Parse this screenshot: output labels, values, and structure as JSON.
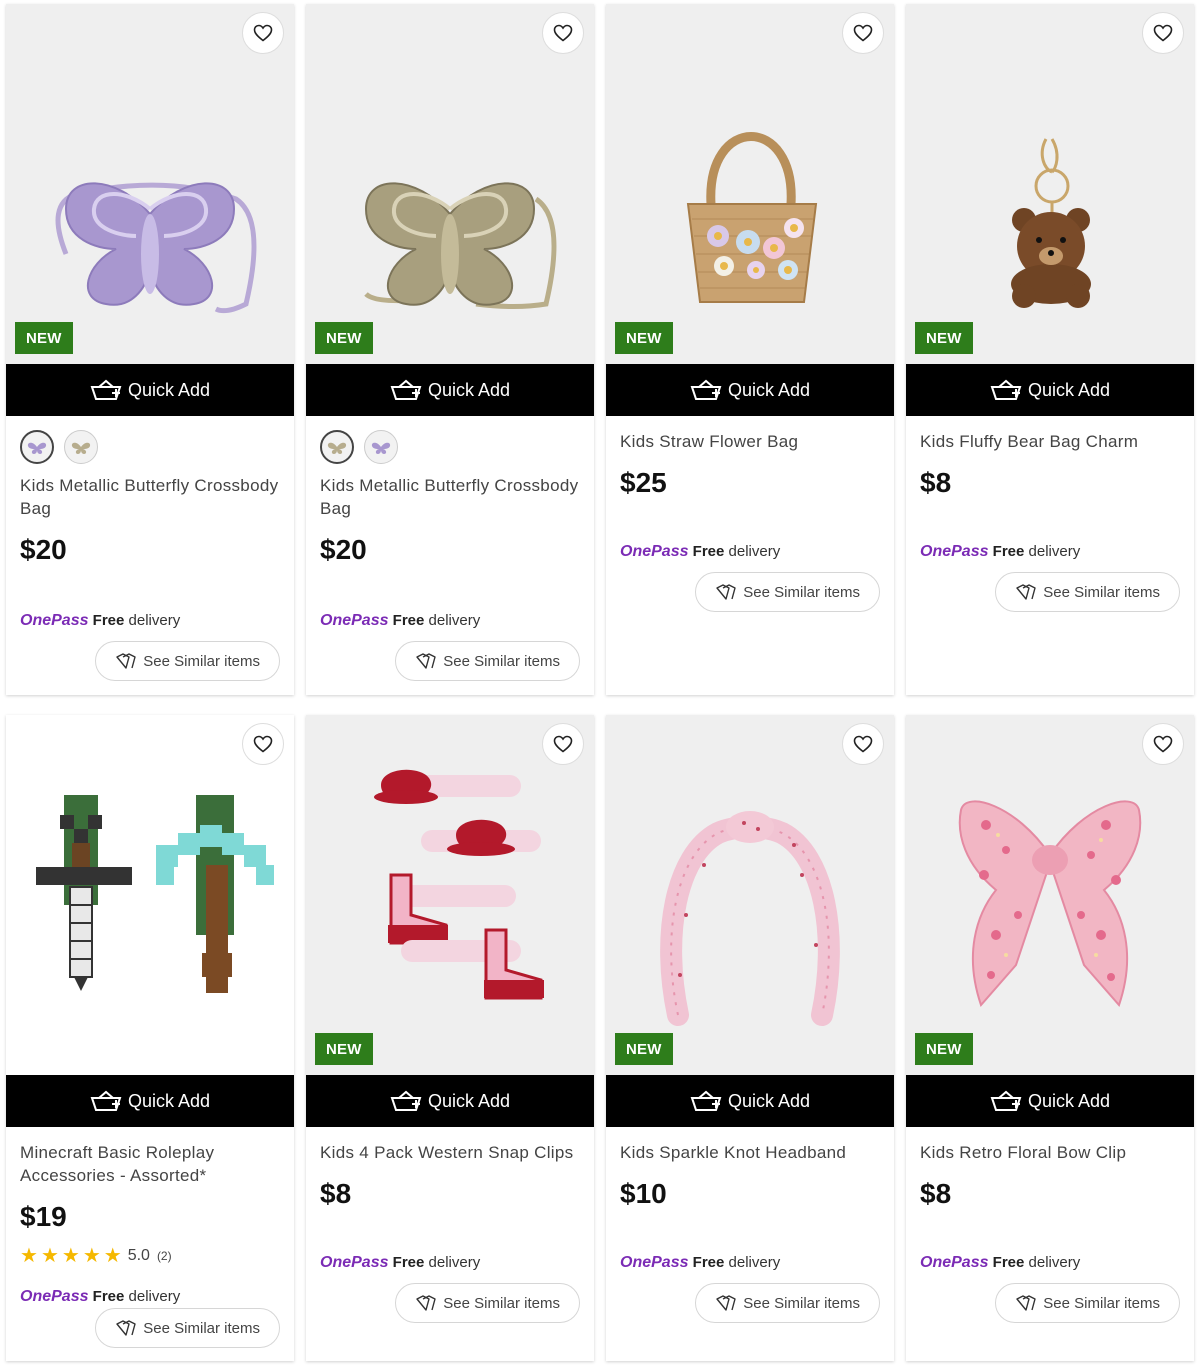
{
  "quick_add_label": "Quick Add",
  "new_badge_label": "NEW",
  "onepass": {
    "brand": "OnePass",
    "free": "Free",
    "delivery": "delivery"
  },
  "see_similar_label": "See Similar items",
  "colors": {
    "badge": "#2e7d1b",
    "onepass": "#7b2bb5",
    "quick_add_bg": "#000000",
    "star": "#f5b800"
  },
  "products": [
    {
      "name": "Kids Metallic Butterfly Crossbody Bag",
      "price": "$20",
      "is_new": true,
      "swatches": [
        "lilac",
        "gold"
      ],
      "selected_swatch": 0,
      "image": "lilac-butterfly-bag"
    },
    {
      "name": "Kids Metallic Butterfly Crossbody Bag",
      "price": "$20",
      "is_new": true,
      "swatches": [
        "gold",
        "lilac"
      ],
      "selected_swatch": 0,
      "image": "gold-butterfly-bag"
    },
    {
      "name": "Kids Straw Flower Bag",
      "price": "$25",
      "is_new": true,
      "image": "straw-flower-bag"
    },
    {
      "name": "Kids Fluffy Bear Bag Charm",
      "price": "$8",
      "is_new": true,
      "image": "bear-charm"
    },
    {
      "name": "Minecraft Basic Roleplay Accessories - Assorted*",
      "price": "$19",
      "is_new": false,
      "rating": "5.0",
      "rating_count": "(2)",
      "stars": 5,
      "image": "minecraft-sword-pickaxe"
    },
    {
      "name": "Kids 4 Pack Western Snap Clips",
      "price": "$8",
      "is_new": true,
      "image": "western-clips"
    },
    {
      "name": "Kids Sparkle Knot Headband",
      "price": "$10",
      "is_new": true,
      "image": "headband"
    },
    {
      "name": "Kids Retro Floral Bow Clip",
      "price": "$8",
      "is_new": true,
      "image": "floral-bow"
    }
  ]
}
